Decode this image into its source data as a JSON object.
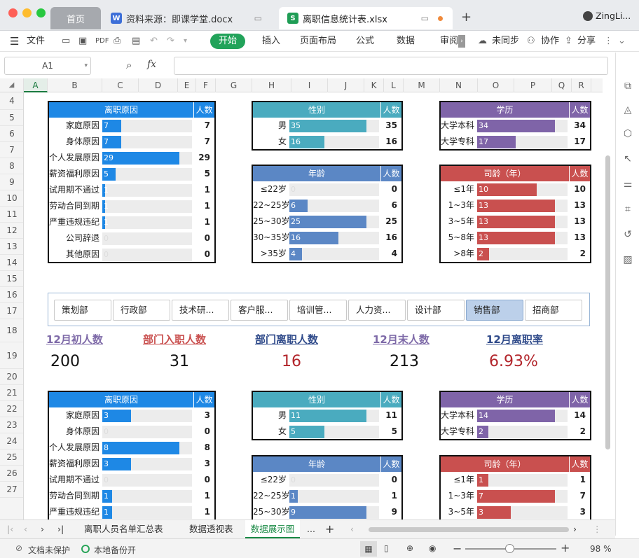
{
  "window": {
    "tabs": [
      {
        "label": "首页"
      },
      {
        "label": "资料来源：即课学堂.docx"
      },
      {
        "label": "离职信息统计表.xlsx"
      }
    ],
    "user": "ZingLi..."
  },
  "toolbar": {
    "file": "文件",
    "ribbon": [
      "开始",
      "插入",
      "页面布局",
      "公式",
      "数据",
      "审阅"
    ],
    "sync": "未同步",
    "collab": "协作",
    "share": "分享"
  },
  "formula": {
    "cell_ref": "A1",
    "fx": "fx",
    "value": ""
  },
  "columns": [
    "A",
    "B",
    "C",
    "D",
    "E",
    "F",
    "G",
    "H",
    "I",
    "J",
    "K",
    "L",
    "M",
    "N",
    "O",
    "P",
    "Q",
    "R"
  ],
  "rows": [
    "4",
    "5",
    "6",
    "7",
    "8",
    "9",
    "10",
    "11",
    "12",
    "13",
    "14",
    "15",
    "16",
    "17",
    "18",
    "19",
    "20",
    "21",
    "22",
    "23",
    "24",
    "25",
    "26",
    "27"
  ],
  "panels": {
    "reason_top": {
      "title": "离职原因",
      "count_header": "人数",
      "color": "#1e88e5",
      "max": 29,
      "items": [
        {
          "label": "家庭原因",
          "value": 7
        },
        {
          "label": "身体原因",
          "value": 7
        },
        {
          "label": "个人发展原因",
          "value": 29
        },
        {
          "label": "薪资福利原因",
          "value": 5
        },
        {
          "label": "试用期不通过",
          "value": 1
        },
        {
          "label": "劳动合同到期",
          "value": 1
        },
        {
          "label": "严重违规违纪",
          "value": 1
        },
        {
          "label": "公司辞退",
          "value": 0
        },
        {
          "label": "其他原因",
          "value": 0
        }
      ]
    },
    "gender_top": {
      "title": "性别",
      "count_header": "人数",
      "color": "#4aabbf",
      "max": 35,
      "items": [
        {
          "label": "男",
          "value": 35
        },
        {
          "label": "女",
          "value": 16
        }
      ]
    },
    "edu_top": {
      "title": "学历",
      "count_header": "人数",
      "color": "#7f64a8",
      "max": 34,
      "items": [
        {
          "label": "大学本科",
          "value": 34
        },
        {
          "label": "大学专科",
          "value": 17
        }
      ]
    },
    "age_top": {
      "title": "年龄",
      "count_header": "人数",
      "color": "#5b87c5",
      "max": 25,
      "items": [
        {
          "label": "≤22岁",
          "value": 0
        },
        {
          "label": "22~25岁",
          "value": 6
        },
        {
          "label": "25~30岁",
          "value": 25
        },
        {
          "label": "30~35岁",
          "value": 16
        },
        {
          "label": ">35岁",
          "value": 4
        }
      ]
    },
    "tenure_top": {
      "title": "司龄（年）",
      "count_header": "人数",
      "color": "#c9504f",
      "max": 13,
      "items": [
        {
          "label": "≤1年",
          "value": 10
        },
        {
          "label": "1~3年",
          "value": 13
        },
        {
          "label": "3~5年",
          "value": 13
        },
        {
          "label": "5~8年",
          "value": 13
        },
        {
          "label": ">8年",
          "value": 2
        }
      ]
    },
    "reason_bot": {
      "title": "离职原因",
      "count_header": "人数",
      "color": "#1e88e5",
      "max": 8,
      "items": [
        {
          "label": "家庭原因",
          "value": 3
        },
        {
          "label": "身体原因",
          "value": 0
        },
        {
          "label": "个人发展原因",
          "value": 8
        },
        {
          "label": "薪资福利原因",
          "value": 3
        },
        {
          "label": "试用期不通过",
          "value": 0
        },
        {
          "label": "劳动合同到期",
          "value": 1
        },
        {
          "label": "严重违规违纪",
          "value": 1
        }
      ]
    },
    "gender_bot": {
      "title": "性别",
      "count_header": "人数",
      "color": "#4aabbf",
      "max": 11,
      "items": [
        {
          "label": "男",
          "value": 11
        },
        {
          "label": "女",
          "value": 5
        }
      ]
    },
    "edu_bot": {
      "title": "学历",
      "count_header": "人数",
      "color": "#7f64a8",
      "max": 14,
      "items": [
        {
          "label": "大学本科",
          "value": 14
        },
        {
          "label": "大学专科",
          "value": 2
        }
      ]
    },
    "age_bot": {
      "title": "年龄",
      "count_header": "人数",
      "color": "#5b87c5",
      "max": 9,
      "items": [
        {
          "label": "≤22岁",
          "value": 0
        },
        {
          "label": "22~25岁",
          "value": 1
        },
        {
          "label": "25~30岁",
          "value": 9
        }
      ]
    },
    "tenure_bot": {
      "title": "司龄（年）",
      "count_header": "人数",
      "color": "#c9504f",
      "max": 7,
      "items": [
        {
          "label": "≤1年",
          "value": 1
        },
        {
          "label": "1~3年",
          "value": 7
        },
        {
          "label": "3~5年",
          "value": 3
        }
      ]
    }
  },
  "slicer": {
    "items": [
      "策划部",
      "行政部",
      "技术研...",
      "客户服...",
      "培训管...",
      "人力资...",
      "设计部",
      "销售部",
      "招商部"
    ],
    "selected": "销售部"
  },
  "kpis": [
    {
      "label": "12月初人数",
      "value": "200",
      "label_color": "#7e6aa8",
      "value_color": "#111"
    },
    {
      "label": "部门入职人数",
      "value": "31",
      "label_color": "#c9504f",
      "value_color": "#111"
    },
    {
      "label": "部门离职人数",
      "value": "16",
      "label_color": "#2f4a8a",
      "value_color": "#b2252b"
    },
    {
      "label": "12月末人数",
      "value": "213",
      "label_color": "#7e6aa8",
      "value_color": "#111"
    },
    {
      "label": "12月离职率",
      "value": "6.93%",
      "label_color": "#2f4a8a",
      "value_color": "#b2252b"
    }
  ],
  "sheets": {
    "tabs": [
      "离职人员名单汇总表",
      "数据透视表",
      "数据展示图"
    ],
    "active": "数据展示图",
    "more": "..."
  },
  "status": {
    "protect": "文档未保护",
    "backup": "本地备份开",
    "zoom": "98 %"
  }
}
